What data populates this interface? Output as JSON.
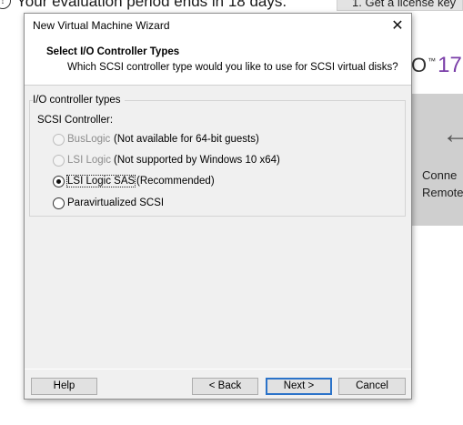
{
  "background": {
    "banner_text": "Your evaluation period ends in 18 days.",
    "license_button": "1. Get a license key",
    "brand_version": "17",
    "panel_lines": [
      "Conne",
      "Remote"
    ]
  },
  "dialog": {
    "title": "New Virtual Machine Wizard",
    "close_glyph": "✕",
    "header": {
      "title": "Select I/O Controller Types",
      "subtitle": "Which SCSI controller type would you like to use for SCSI virtual disks?"
    },
    "group": {
      "legend": "I/O controller types",
      "label": "SCSI Controller:",
      "options": [
        {
          "label": "BusLogic",
          "note": "(Not available for 64-bit guests)",
          "enabled": false,
          "selected": false
        },
        {
          "label": "LSI Logic",
          "note": "(Not supported by Windows 10 x64)",
          "enabled": false,
          "selected": false
        },
        {
          "label": "LSI Logic SAS",
          "note": "(Recommended)",
          "enabled": true,
          "selected": true
        },
        {
          "label": "Paravirtualized SCSI",
          "note": "",
          "enabled": true,
          "selected": false
        }
      ]
    },
    "buttons": {
      "help": "Help",
      "back": "< Back",
      "next": "Next >",
      "cancel": "Cancel"
    }
  }
}
